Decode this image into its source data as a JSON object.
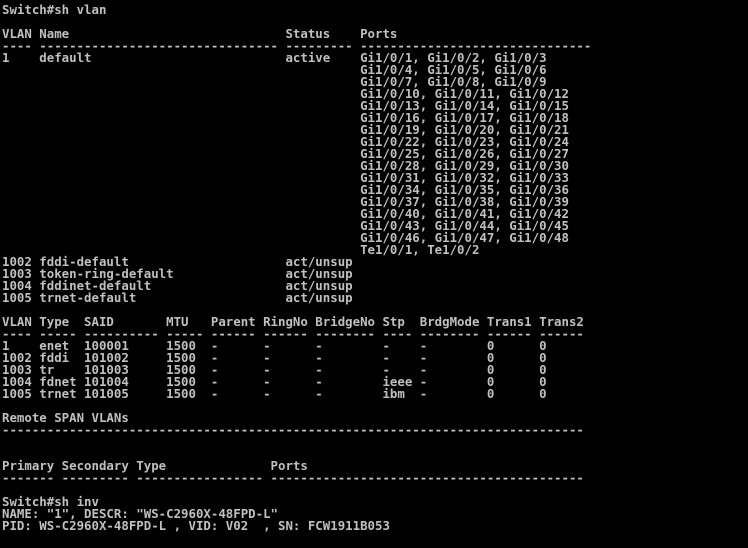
{
  "terminal": {
    "lines": [
      "Switch#sh vlan",
      "",
      "VLAN Name                             Status    Ports",
      "---- -------------------------------- --------- -------------------------------",
      "1    default                          active    Gi1/0/1, Gi1/0/2, Gi1/0/3",
      "                                                Gi1/0/4, Gi1/0/5, Gi1/0/6",
      "                                                Gi1/0/7, Gi1/0/8, Gi1/0/9",
      "                                                Gi1/0/10, Gi1/0/11, Gi1/0/12",
      "                                                Gi1/0/13, Gi1/0/14, Gi1/0/15",
      "                                                Gi1/0/16, Gi1/0/17, Gi1/0/18",
      "                                                Gi1/0/19, Gi1/0/20, Gi1/0/21",
      "                                                Gi1/0/22, Gi1/0/23, Gi1/0/24",
      "                                                Gi1/0/25, Gi1/0/26, Gi1/0/27",
      "                                                Gi1/0/28, Gi1/0/29, Gi1/0/30",
      "                                                Gi1/0/31, Gi1/0/32, Gi1/0/33",
      "                                                Gi1/0/34, Gi1/0/35, Gi1/0/36",
      "                                                Gi1/0/37, Gi1/0/38, Gi1/0/39",
      "                                                Gi1/0/40, Gi1/0/41, Gi1/0/42",
      "                                                Gi1/0/43, Gi1/0/44, Gi1/0/45",
      "                                                Gi1/0/46, Gi1/0/47, Gi1/0/48",
      "                                                Te1/0/1, Te1/0/2",
      "1002 fddi-default                     act/unsup",
      "1003 token-ring-default               act/unsup",
      "1004 fddinet-default                  act/unsup",
      "1005 trnet-default                    act/unsup",
      "",
      "VLAN Type  SAID       MTU   Parent RingNo BridgeNo Stp  BrdgMode Trans1 Trans2",
      "---- ----- ---------- ----- ------ ------ -------- ---- -------- ------ ------",
      "1    enet  100001     1500  -      -      -        -    -        0      0",
      "1002 fddi  101002     1500  -      -      -        -    -        0      0",
      "1003 tr    101003     1500  -      -      -        -    -        0      0",
      "1004 fdnet 101004     1500  -      -      -        ieee -        0      0",
      "1005 trnet 101005     1500  -      -      -        ibm  -        0      0",
      "",
      "Remote SPAN VLANs",
      "------------------------------------------------------------------------------",
      "",
      "",
      "Primary Secondary Type              Ports",
      "------- --------- ----------------- ------------------------------------------",
      "",
      "Switch#sh inv",
      "NAME: \"1\", DESCR: \"WS-C2960X-48FPD-L\"",
      "PID: WS-C2960X-48FPD-L , VID: V02  , SN: FCW1911B053",
      ""
    ]
  }
}
